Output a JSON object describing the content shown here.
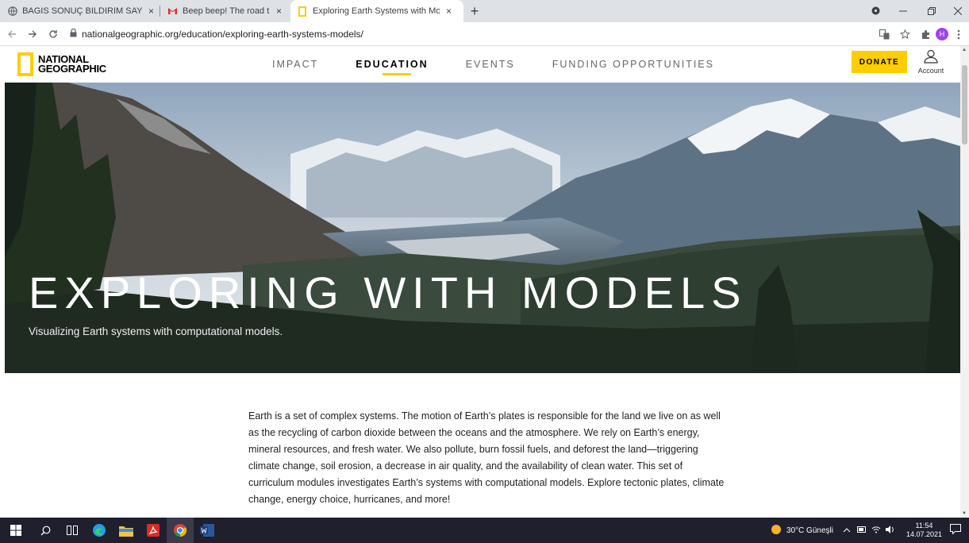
{
  "browser": {
    "tabs": [
      {
        "label": "BAGIS SONUÇ BILDIRIM SAYFASI",
        "icon": "globe-icon"
      },
      {
        "label": "Beep beep! The road trip has be",
        "icon": "gmail-icon"
      },
      {
        "label": "Exploring Earth Systems with Mo",
        "icon": "natgeo-icon",
        "active": true
      }
    ],
    "close_glyph": "×",
    "new_tab_glyph": "+",
    "url": "nationalgeographic.org/education/exploring-earth-systems-models/",
    "profile_initial": "H"
  },
  "site": {
    "logo_line1": "NATIONAL",
    "logo_line2": "GEOGRAPHIC",
    "nav": [
      "IMPACT",
      "EDUCATION",
      "EVENTS",
      "FUNDING OPPORTUNITIES"
    ],
    "active_nav": "EDUCATION",
    "donate_label": "DONATE",
    "account_label": "Account"
  },
  "hero": {
    "title": "EXPLORING WITH MODELS",
    "subtitle": "Visualizing Earth systems with computational models."
  },
  "intro_text": "Earth is a set of complex systems. The motion of Earth’s plates is responsible for the land we live on as well as the recycling of carbon dioxide between the oceans and the atmosphere. We rely on Earth’s energy, mineral resources, and fresh water. We also pollute, burn fossil fuels, and deforest the land—triggering climate change, soil erosion, a decrease in air quality, and the availability of clean water. This set of curriculum modules investigates Earth’s systems with computational models. Explore tectonic plates, climate change, energy choice, hurricanes, and more!",
  "taskbar": {
    "weather": "30°C Güneşli",
    "time": "11:54",
    "date": "14.07.2021"
  },
  "colors": {
    "brand_yellow": "#ffce00",
    "taskbar": "#1f1f2e"
  }
}
